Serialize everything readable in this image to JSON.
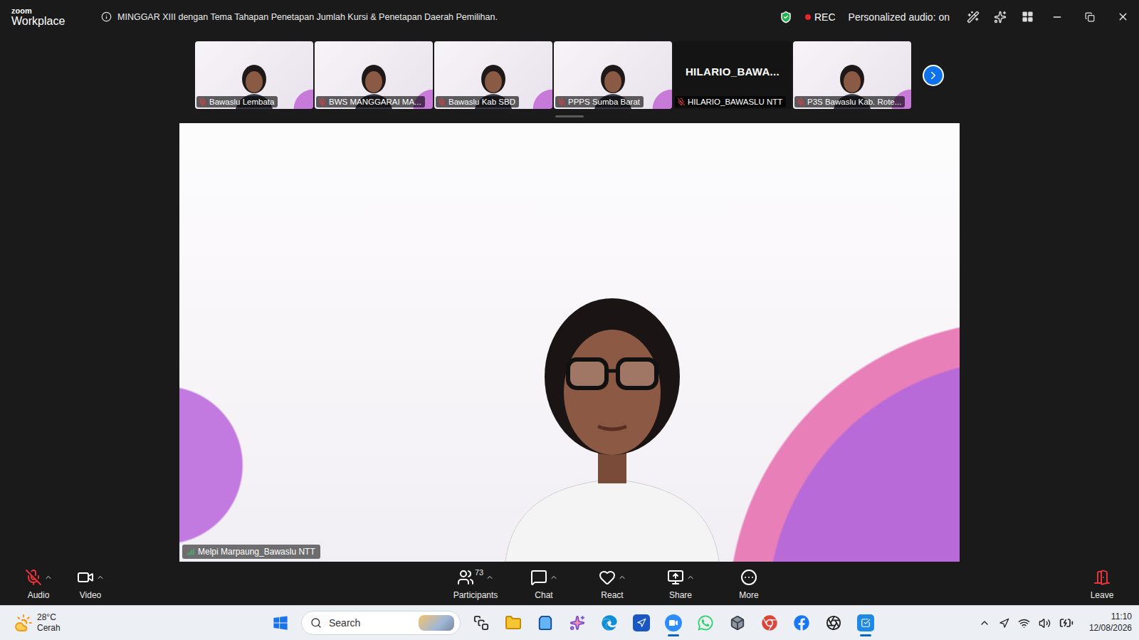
{
  "window": {
    "brand_top": "zoom",
    "brand_bottom": "Workplace",
    "title": "MINGGAR XIII dengan Tema Tahapan Penetapan Jumlah Kursi & Penetapan Daerah Pemilihan.",
    "secure": true,
    "recording": true,
    "rec_label": "REC",
    "audio_mode": "Personalized audio: on"
  },
  "gallery": [
    {
      "name": "Bawaslu Lembata",
      "muted": true,
      "video": true
    },
    {
      "name": "BWS MANGGARAI MA...",
      "muted": true,
      "video": true
    },
    {
      "name": "Bawaslu Kab SBD",
      "muted": true,
      "video": true
    },
    {
      "name": "PPPS Sumba Barat",
      "muted": true,
      "video": true
    },
    {
      "name": "HILARIO_BAWASLU NTT",
      "display_name": "HILARIO_BAWA...",
      "muted": true,
      "video": false
    },
    {
      "name": "P3S Bawaslu Kab. Rote...",
      "muted": true,
      "video": true
    }
  ],
  "speaker": {
    "name": "Melpi Marpaung_Bawaslu NTT"
  },
  "toolbar": {
    "audio": {
      "label": "Audio",
      "muted": true,
      "has_menu": true
    },
    "video": {
      "label": "Video",
      "off": false,
      "has_menu": true
    },
    "items": [
      {
        "label": "Participants",
        "count": "73",
        "has_menu": true
      },
      {
        "label": "Chat",
        "has_menu": true
      },
      {
        "label": "React",
        "has_menu": true
      },
      {
        "label": "Share",
        "has_menu": true
      },
      {
        "label": "More",
        "has_menu": false
      }
    ],
    "leave": {
      "label": "Leave"
    }
  },
  "taskbar": {
    "weather": {
      "temp": "28°C",
      "condition": "Cerah"
    },
    "search": {
      "placeholder": "Search"
    },
    "apps": [
      {
        "active": false
      },
      {
        "active": false
      },
      {
        "active": false
      },
      {
        "active": false
      },
      {
        "active": false
      },
      {
        "active": false
      },
      {
        "active": true
      },
      {
        "active": false
      },
      {
        "active": false
      },
      {
        "active": false
      },
      {
        "active": false
      },
      {
        "active": false
      },
      {
        "active": true
      }
    ],
    "clock": {
      "time": "11:10",
      "date": "12/08/2026"
    }
  }
}
